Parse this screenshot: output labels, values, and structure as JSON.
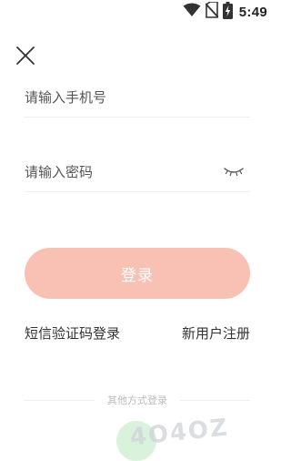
{
  "status_bar": {
    "time": "5:49",
    "icons": [
      "wifi-icon",
      "no-sim-icon",
      "battery-charging-icon"
    ]
  },
  "close_icon": "close-icon",
  "phone_field": {
    "placeholder": "请输入手机号",
    "value": ""
  },
  "password_field": {
    "placeholder": "请输入密码",
    "value": "",
    "toggle_icon": "eye-closed-icon"
  },
  "login_button": {
    "label": "登录",
    "color": "#f9c1b4"
  },
  "links": {
    "sms_login": "短信验证码登录",
    "register": "新用户注册"
  },
  "other_methods": {
    "label": "其他方式登录",
    "icons": [
      "wechat-icon"
    ]
  },
  "watermark": {
    "text": "4O4OZ"
  }
}
